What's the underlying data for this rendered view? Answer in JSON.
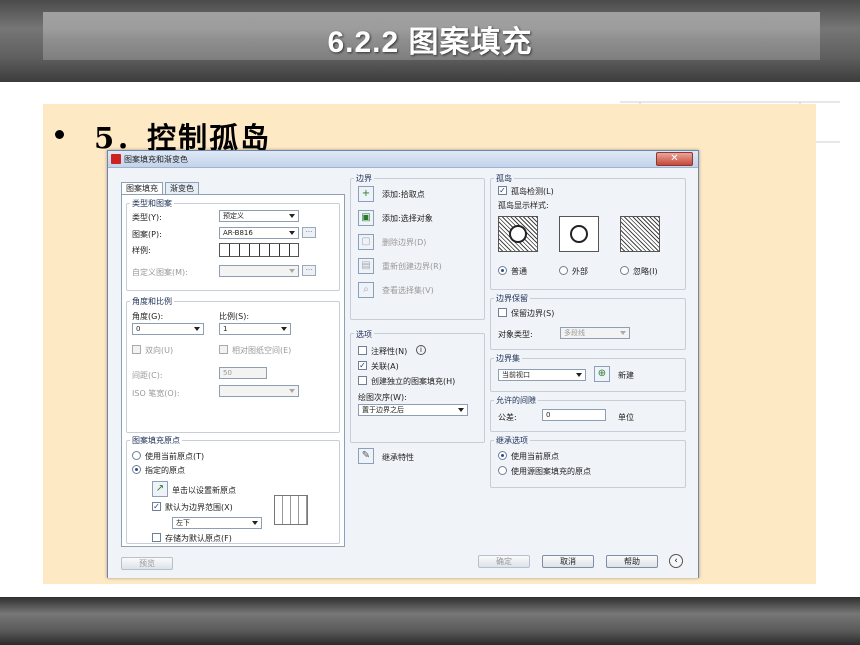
{
  "slide": {
    "title": "6.2.2  图案填充",
    "bullet": "5．控制孤岛"
  },
  "dialog": {
    "title": "图案填充和渐变色",
    "close_icon": "close-icon",
    "tabs": [
      "图案填充",
      "渐变色"
    ],
    "type_pattern": {
      "title": "类型和图案",
      "type_label": "类型(Y):",
      "type_value": "预定义",
      "pattern_label": "图案(P):",
      "pattern_value": "AR-B816",
      "swatch_label": "样例:",
      "custom_label": "自定义图案(M):"
    },
    "angle_scale": {
      "title": "角度和比例",
      "angle_label": "角度(G):",
      "angle_value": "0",
      "scale_label": "比例(S):",
      "scale_value": "1",
      "double_label": "双向(U)",
      "relative_label": "相对图纸空间(E)",
      "spacing_label": "间距(C):",
      "spacing_value": "50",
      "iso_label": "ISO 笔宽(O):"
    },
    "origin": {
      "title": "图案填充原点",
      "use_current": "使用当前原点(T)",
      "specified": "指定的原点",
      "click_set": "单击以设置新原点",
      "default_extent": "默认为边界范围(X)",
      "position_value": "左下",
      "store_default": "存储为默认原点(F)"
    },
    "boundaries": {
      "title": "边界",
      "add_pick": "添加:拾取点",
      "add_select": "添加:选择对象",
      "remove": "删除边界(D)",
      "recreate": "重新创建边界(R)",
      "view_sel": "查看选择集(V)"
    },
    "options": {
      "title": "选项",
      "annotative": "注释性(N)",
      "associative": "关联(A)",
      "separate": "创建独立的图案填充(H)",
      "draw_order_label": "绘图次序(W):",
      "draw_order_value": "置于边界之后",
      "inherit": "继承特性"
    },
    "islands": {
      "title": "孤岛",
      "detect": "孤岛检测(L)",
      "display_style": "孤岛显示样式:",
      "normal": "普通",
      "outer": "外部",
      "ignore": "忽略(I)"
    },
    "retain": {
      "title": "边界保留",
      "retain_label": "保留边界(S)",
      "object_type_label": "对象类型:",
      "object_type_value": "多段线"
    },
    "boundary_set": {
      "title": "边界集",
      "value": "当前视口",
      "new_label": "新建"
    },
    "gap": {
      "title": "允许的间隙",
      "tol_label": "公差:",
      "tol_value": "0",
      "unit_label": "单位"
    },
    "inherit_opts": {
      "title": "继承选项",
      "use_current": "使用当前原点",
      "use_source": "使用源图案填充的原点"
    },
    "buttons": {
      "preview": "预览",
      "ok": "确定",
      "cancel": "取消",
      "help": "帮助",
      "more_icon": "collapse-arrow-icon"
    }
  }
}
